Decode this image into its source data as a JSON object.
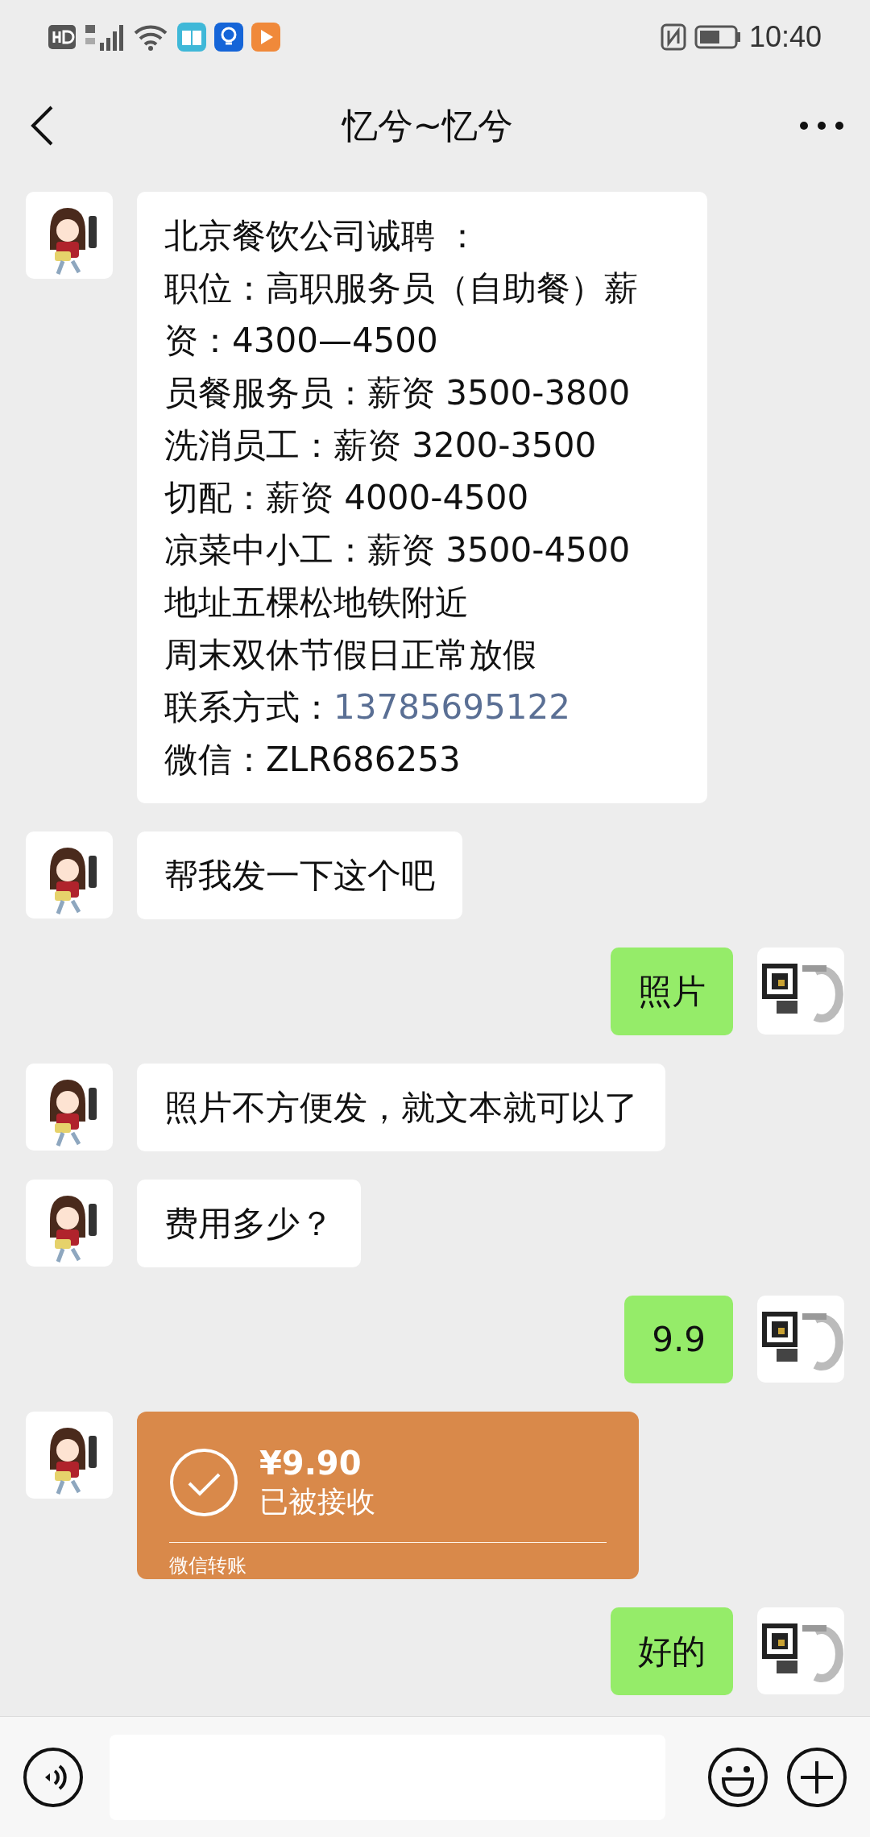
{
  "status_bar": {
    "time": "10:40"
  },
  "header": {
    "title": "忆兮~忆兮"
  },
  "messages": [
    {
      "kind": "text",
      "outgoing": false,
      "paragraphs": [
        {
          "text": "北京餐饮公司诚聘 ："
        },
        {
          "text": "职位：高职服务员（自助餐）薪资：4300—4500"
        },
        {
          "text": "员餐服务员：薪资 3500-3800"
        },
        {
          "text": "洗消员工：薪资 3200-3500"
        },
        {
          "text": "切配：薪资 4000-4500"
        },
        {
          "text": "凉菜中小工：薪资 3500-4500"
        },
        {
          "text": "地址五棵松地铁附近"
        },
        {
          "text": "周末双休节假日正常放假"
        },
        {
          "text": "联系方式：",
          "link": "13785695122"
        },
        {
          "text": "微信：ZLR686253"
        }
      ]
    },
    {
      "kind": "text",
      "outgoing": false,
      "paragraphs": [
        {
          "text": "帮我发一下这个吧"
        }
      ]
    },
    {
      "kind": "text",
      "outgoing": true,
      "paragraphs": [
        {
          "text": "照片"
        }
      ]
    },
    {
      "kind": "text",
      "outgoing": false,
      "paragraphs": [
        {
          "text": "照片不方便发，就文本就可以了"
        }
      ]
    },
    {
      "kind": "text",
      "outgoing": false,
      "paragraphs": [
        {
          "text": "费用多少？"
        }
      ]
    },
    {
      "kind": "text",
      "outgoing": true,
      "paragraphs": [
        {
          "text": "9.9"
        }
      ]
    },
    {
      "kind": "transfer",
      "outgoing": false,
      "amount": "¥9.90",
      "status": "已被接收",
      "footer": "微信转账"
    },
    {
      "kind": "text",
      "outgoing": true,
      "paragraphs": [
        {
          "text": "好的"
        }
      ]
    }
  ]
}
